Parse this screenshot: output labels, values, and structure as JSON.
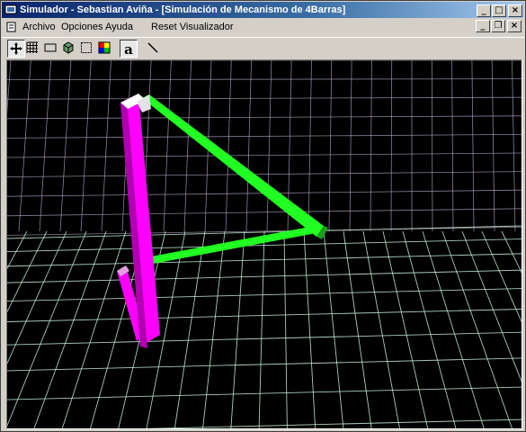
{
  "window": {
    "title": "Simulador - Sebastian Aviña - [Simulación de Mecanismo de 4Barras]"
  },
  "caption_buttons": {
    "minimize": "_",
    "maximize": "□",
    "close": "×",
    "restore": "❐"
  },
  "menu": {
    "items": [
      "Archivo",
      "Opciones",
      "Ayuda",
      "Reset Visualizador"
    ]
  },
  "toolbar": {
    "buttons": [
      {
        "icon": "move-icon",
        "pressed": true
      },
      {
        "icon": "grid-icon",
        "pressed": false
      },
      {
        "icon": "rectangle-icon",
        "pressed": false
      },
      {
        "icon": "cube-icon",
        "pressed": false
      },
      {
        "icon": "dashed-box-icon",
        "pressed": false
      },
      {
        "icon": "color-palette-icon",
        "pressed": false
      },
      {
        "icon": "text-icon",
        "label": "a",
        "pressed": true
      },
      {
        "icon": "line-icon",
        "pressed": false
      }
    ]
  },
  "scene": {
    "background": "#000000",
    "grid_color_back": "#b8a6c8",
    "grid_color_floor": "#c8f0d8",
    "link_magenta": "#ff00ff",
    "link_green": "#22ff22"
  }
}
